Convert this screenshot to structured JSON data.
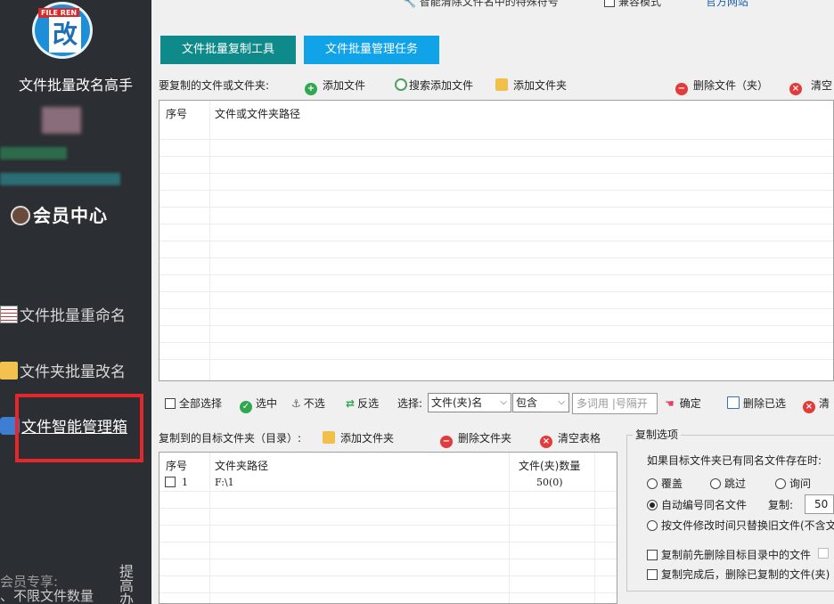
{
  "sidebar": {
    "logo_badge": "FILE REN",
    "logo_char": "改",
    "app_title": "文件批量改名高手",
    "vip_label": "会员中心",
    "nav": [
      {
        "label": "文件批量重命名",
        "icon": "document-list-icon"
      },
      {
        "label": "文件夹批量改名",
        "icon": "folder-icon"
      },
      {
        "label": "文件智能管理箱",
        "icon": "toolbox-icon",
        "active": true
      }
    ],
    "member_line1": "会员专享:",
    "member_line2": "、不限文件数量",
    "upgrade_text": "提高办",
    "highlight_color": "#e5262a"
  },
  "topbar": {
    "clean_label": "智能清除文件名中的特殊符号",
    "compat_label": "兼容模式",
    "website_label": "官方网站"
  },
  "tabs": [
    {
      "label": "文件批量复制工具",
      "color": "#0f8a8a"
    },
    {
      "label": "文件批量管理任务",
      "color": "#10a3e8"
    }
  ],
  "source": {
    "section_label": "要复制的文件或文件夹:",
    "add_file": "添加文件",
    "search_add_file": "搜索添加文件",
    "add_folder": "添加文件夹",
    "delete_file": "删除文件（夹）",
    "clear": "清空",
    "columns": [
      "序号",
      "文件或文件夹路径"
    ]
  },
  "selection_bar": {
    "select_all": "全部选择",
    "select": "选中",
    "unselect": "不选",
    "invert": "反选",
    "select_label": "选择:",
    "field_value": "文件(夹)名",
    "match_value": "包含",
    "keyword_placeholder": "多词用 |号隔开",
    "confirm": "确定",
    "delete_selected": "删除已选",
    "clear": "清"
  },
  "target": {
    "section_label": "复制到的目标文件夹（目录）:",
    "add_folder": "添加文件夹",
    "delete_folder": "删除文件夹",
    "clear_table": "清空表格",
    "columns": [
      "序号",
      "文件夹路径",
      "文件(夹)数量"
    ],
    "rows": [
      {
        "index": "1",
        "path": "F:\\1",
        "count": "50(0)"
      }
    ]
  },
  "copy_options": {
    "title": "复制选项",
    "conflict_label": "如果目标文件夹已有同名文件存在时:",
    "overwrite": "覆盖",
    "skip": "跳过",
    "ask": "询问",
    "auto_number": "自动编号同名文件",
    "copies_label": "复制:",
    "copies_value": "50",
    "by_mtime": "按文件修改时间只替换旧文件(不含文",
    "delete_before": "复制前先删除目标目录中的文件",
    "delete_after": "复制完成后，删除已复制的文件(夹)"
  }
}
